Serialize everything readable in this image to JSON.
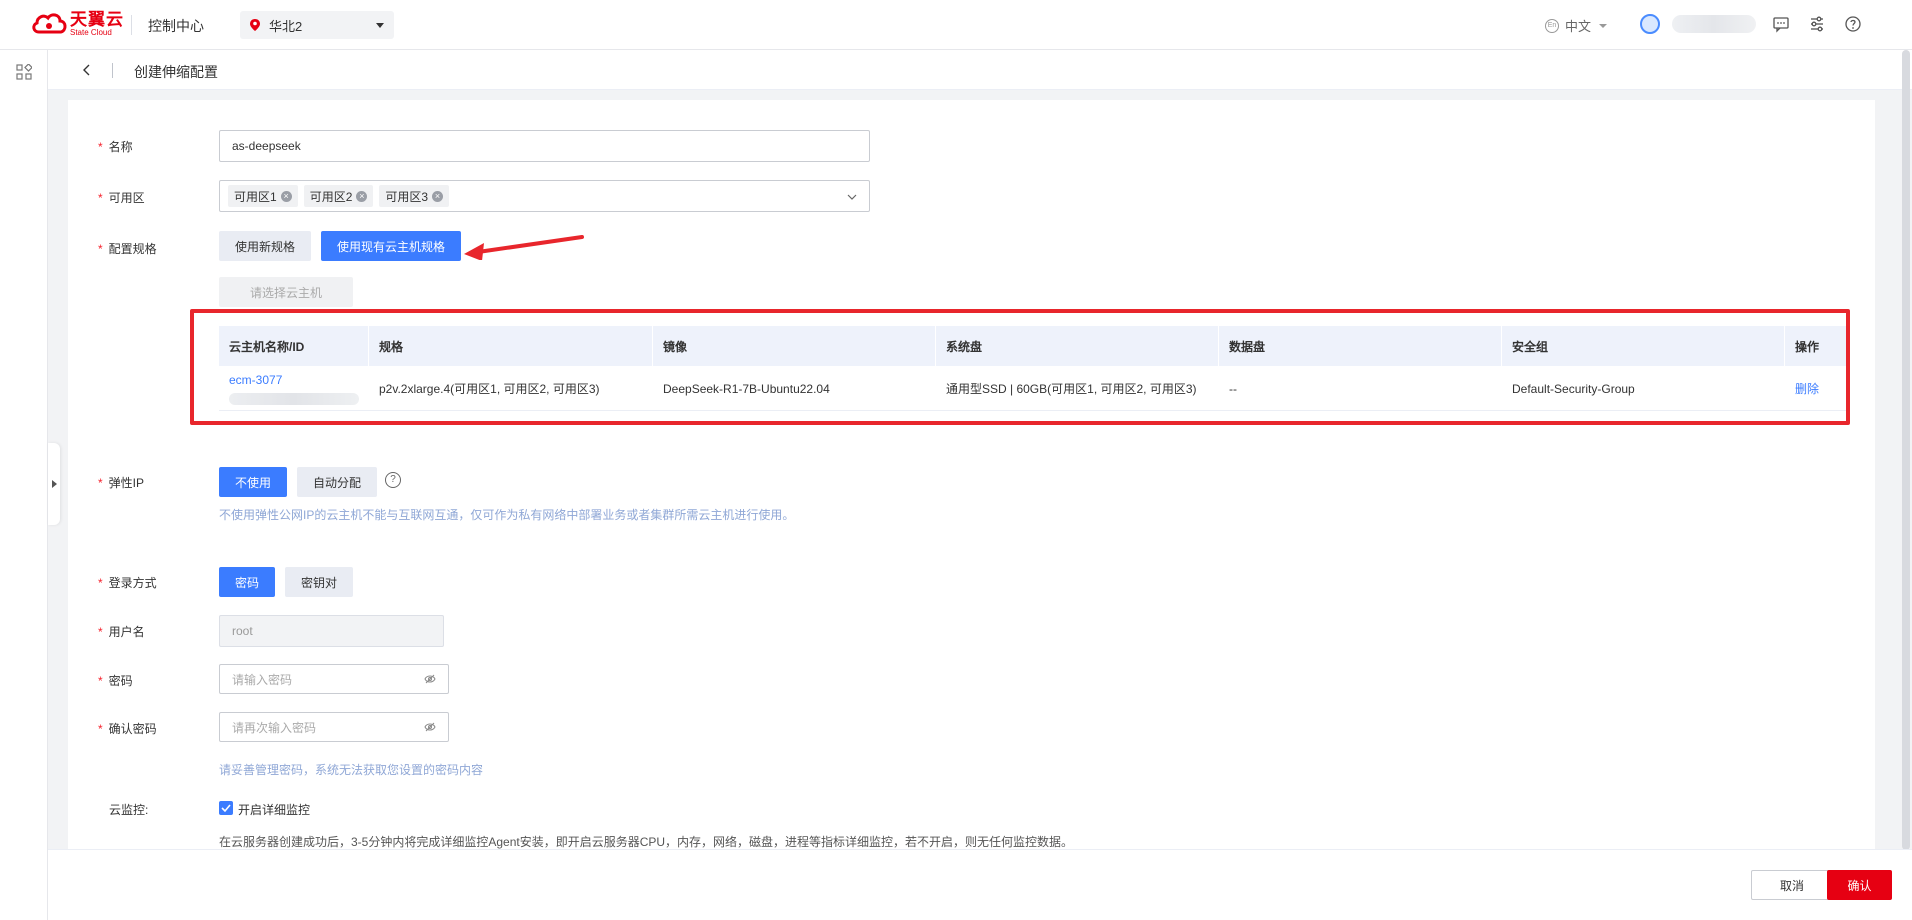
{
  "topbar": {
    "logo_cn": "天翼云",
    "logo_en": "State Cloud",
    "console": "控制中心",
    "region": "华北2",
    "language": "中文",
    "globe_label": "En"
  },
  "header": {
    "title": "创建伸缩配置"
  },
  "form": {
    "name": {
      "label": "名称",
      "value": "as-deepseek"
    },
    "zone": {
      "label": "可用区",
      "tags": [
        "可用区1",
        "可用区2",
        "可用区3"
      ]
    },
    "spec": {
      "label": "配置规格",
      "option_new": "使用新规格",
      "option_existing": "使用现有云主机规格",
      "select_vm": "请选择云主机"
    },
    "table": {
      "headers": [
        "云主机名称/ID",
        "规格",
        "镜像",
        "系统盘",
        "数据盘",
        "安全组",
        "操作"
      ],
      "row": {
        "name": "ecm-3077",
        "spec": "p2v.2xlarge.4(可用区1, 可用区2, 可用区3)",
        "image": "DeepSeek-R1-7B-Ubuntu22.04",
        "system_disk": "通用型SSD | 60GB(可用区1, 可用区2, 可用区3)",
        "data_disk": "--",
        "security_group": "Default-Security-Group",
        "action": "删除"
      }
    },
    "eip": {
      "label": "弹性IP",
      "option_none": "不使用",
      "option_auto": "自动分配",
      "help": "?",
      "hint": "不使用弹性公网IP的云主机不能与互联网互通，仅可作为私有网络中部署业务或者集群所需云主机进行使用。"
    },
    "login": {
      "label": "登录方式",
      "option_password": "密码",
      "option_keypair": "密钥对"
    },
    "username": {
      "label": "用户名",
      "value": "root"
    },
    "password": {
      "label": "密码",
      "placeholder": "请输入密码"
    },
    "confirm_password": {
      "label": "确认密码",
      "placeholder": "请再次输入密码"
    },
    "password_hint": "请妥善管理密码，系统无法获取您设置的密码内容",
    "monitor": {
      "label": "云监控:",
      "checkbox_label": "开启详细监控",
      "checked": true,
      "desc": "在云服务器创建成功后，3-5分钟内将完成详细监控Agent安装，即开启云服务器CPU，内存，网络，磁盘，进程等指标详细监控，若不开启，则无任何监控数据。"
    }
  },
  "footer": {
    "cancel": "取消",
    "confirm": "确认"
  },
  "colors": {
    "primary": "#3b7cff",
    "brand": "#e60012",
    "highlight": "#e8262c"
  }
}
